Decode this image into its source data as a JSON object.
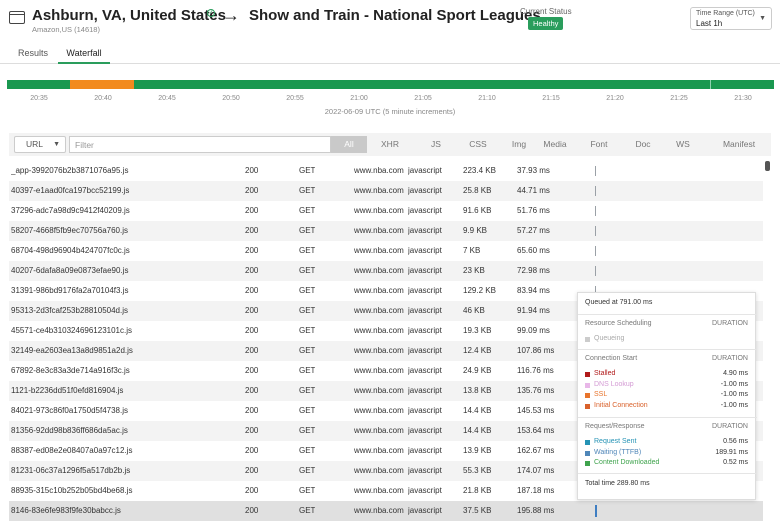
{
  "header": {
    "location": "Ashburn, VA, United States",
    "location_sub": "Amazon,US (14618)",
    "arrow": "→",
    "test_name": "Show and Train - National Sport Leagues",
    "status_label": "Current Status",
    "status_value": "Healthy",
    "time_range_label": "Time Range (UTC)",
    "time_range_value": "Last 1h",
    "check_icon": "check-circle-icon"
  },
  "tabs": [
    "Results",
    "Waterfall"
  ],
  "active_tab": "Waterfall",
  "timeline": {
    "ticks": [
      "20:35",
      "20:40",
      "20:45",
      "20:50",
      "20:55",
      "21:00",
      "21:05",
      "21:10",
      "21:15",
      "21:20",
      "21:25",
      "21:30"
    ],
    "caption": "2022-06-09 UTC (5 minute increments)",
    "colors": {
      "healthy": "#1a9850",
      "warning": "#f28a1e",
      "selected_border": "#8fd1ae"
    }
  },
  "filter": {
    "url_select": "URL",
    "placeholder": "Filter",
    "types": [
      "All",
      "XHR",
      "JS",
      "CSS",
      "Img",
      "Media",
      "Font",
      "Doc",
      "WS",
      "Manifest"
    ],
    "active_type": "All"
  },
  "rows": [
    {
      "url": "_app-3992076b2b3871076a95.js",
      "status": "200",
      "method": "GET",
      "domain": "www.nba.com",
      "type": "javascript",
      "size": "223.4 KB",
      "time": "37.93 ms"
    },
    {
      "url": "40397-e1aad0fca197bcc52199.js",
      "status": "200",
      "method": "GET",
      "domain": "www.nba.com",
      "type": "javascript",
      "size": "25.8 KB",
      "time": "44.71 ms"
    },
    {
      "url": "37296-adc7a98d9c9412f40209.js",
      "status": "200",
      "method": "GET",
      "domain": "www.nba.com",
      "type": "javascript",
      "size": "91.6 KB",
      "time": "51.76 ms"
    },
    {
      "url": "58207-4668f5fb9ec70756a760.js",
      "status": "200",
      "method": "GET",
      "domain": "www.nba.com",
      "type": "javascript",
      "size": "9.9 KB",
      "time": "57.27 ms"
    },
    {
      "url": "68704-498d96904b424707fc0c.js",
      "status": "200",
      "method": "GET",
      "domain": "www.nba.com",
      "type": "javascript",
      "size": "7 KB",
      "time": "65.60 ms"
    },
    {
      "url": "40207-6dafa8a09e0873efae90.js",
      "status": "200",
      "method": "GET",
      "domain": "www.nba.com",
      "type": "javascript",
      "size": "23 KB",
      "time": "72.98 ms"
    },
    {
      "url": "31391-986bd9176fa2a70104f3.js",
      "status": "200",
      "method": "GET",
      "domain": "www.nba.com",
      "type": "javascript",
      "size": "129.2 KB",
      "time": "83.94 ms"
    },
    {
      "url": "95313-2d3fcaf253b28810504d.js",
      "status": "200",
      "method": "GET",
      "domain": "www.nba.com",
      "type": "javascript",
      "size": "46 KB",
      "time": "91.94 ms"
    },
    {
      "url": "45571-ce4b310324696123101c.js",
      "status": "200",
      "method": "GET",
      "domain": "www.nba.com",
      "type": "javascript",
      "size": "19.3 KB",
      "time": "99.09 ms"
    },
    {
      "url": "32149-ea2603ea13a8d9851a2d.js",
      "status": "200",
      "method": "GET",
      "domain": "www.nba.com",
      "type": "javascript",
      "size": "12.4 KB",
      "time": "107.86 ms"
    },
    {
      "url": "67892-8e3c83a3de714a916f3c.js",
      "status": "200",
      "method": "GET",
      "domain": "www.nba.com",
      "type": "javascript",
      "size": "24.9 KB",
      "time": "116.76 ms"
    },
    {
      "url": "1121-b2236dd51f0efd816904.js",
      "status": "200",
      "method": "GET",
      "domain": "www.nba.com",
      "type": "javascript",
      "size": "13.8 KB",
      "time": "135.76 ms"
    },
    {
      "url": "84021-973c86f0a1750d5f4738.js",
      "status": "200",
      "method": "GET",
      "domain": "www.nba.com",
      "type": "javascript",
      "size": "14.4 KB",
      "time": "145.53 ms"
    },
    {
      "url": "81356-92dd98b836ff686da5ac.js",
      "status": "200",
      "method": "GET",
      "domain": "www.nba.com",
      "type": "javascript",
      "size": "14.4 KB",
      "time": "153.64 ms"
    },
    {
      "url": "88387-ed08e2e08407a0a97c12.js",
      "status": "200",
      "method": "GET",
      "domain": "www.nba.com",
      "type": "javascript",
      "size": "13.9 KB",
      "time": "162.67 ms"
    },
    {
      "url": "81231-06c37a1296f5a517db2b.js",
      "status": "200",
      "method": "GET",
      "domain": "www.nba.com",
      "type": "javascript",
      "size": "55.3 KB",
      "time": "174.07 ms"
    },
    {
      "url": "88935-315c10b252b05bd4be68.js",
      "status": "200",
      "method": "GET",
      "domain": "www.nba.com",
      "type": "javascript",
      "size": "21.8 KB",
      "time": "187.18 ms"
    },
    {
      "url": "8146-83e6fe983f9fe30babcc.js",
      "status": "200",
      "method": "GET",
      "domain": "www.nba.com",
      "type": "javascript",
      "size": "37.5 KB",
      "time": "195.88 ms"
    }
  ],
  "tooltip": {
    "queued": "Queued at 791.00 ms",
    "sections": [
      {
        "title": "Resource Scheduling",
        "duration": "DURATION",
        "items": [
          {
            "label": "Queueing",
            "value": "",
            "color": "#cccccc",
            "text_color": "#aaaaaa"
          }
        ]
      },
      {
        "title": "Connection Start",
        "duration": "DURATION",
        "items": [
          {
            "label": "Stalled",
            "value": "4.90 ms",
            "color": "#b01a1a",
            "text_color": "#b01a1a"
          },
          {
            "label": "DNS Lookup",
            "value": "-1.00 ms",
            "color": "#e8b7e8",
            "text_color": "#d49bd4"
          },
          {
            "label": "SSL",
            "value": "-1.00 ms",
            "color": "#e8742c",
            "text_color": "#e8742c"
          },
          {
            "label": "Initial Connection",
            "value": "-1.00 ms",
            "color": "#d9612b",
            "text_color": "#d9612b"
          }
        ]
      },
      {
        "title": "Request/Response",
        "duration": "DURATION",
        "items": [
          {
            "label": "Request Sent",
            "value": "0.56 ms",
            "color": "#2593b5",
            "text_color": "#2593b5"
          },
          {
            "label": "Waiting (TTFB)",
            "value": "189.91 ms",
            "color": "#4f86b8",
            "text_color": "#4f86b8"
          },
          {
            "label": "Content Downloaded",
            "value": "0.52 ms",
            "color": "#3fa34d",
            "text_color": "#3fa34d"
          }
        ]
      }
    ],
    "total": "Total time 289.80 ms"
  }
}
